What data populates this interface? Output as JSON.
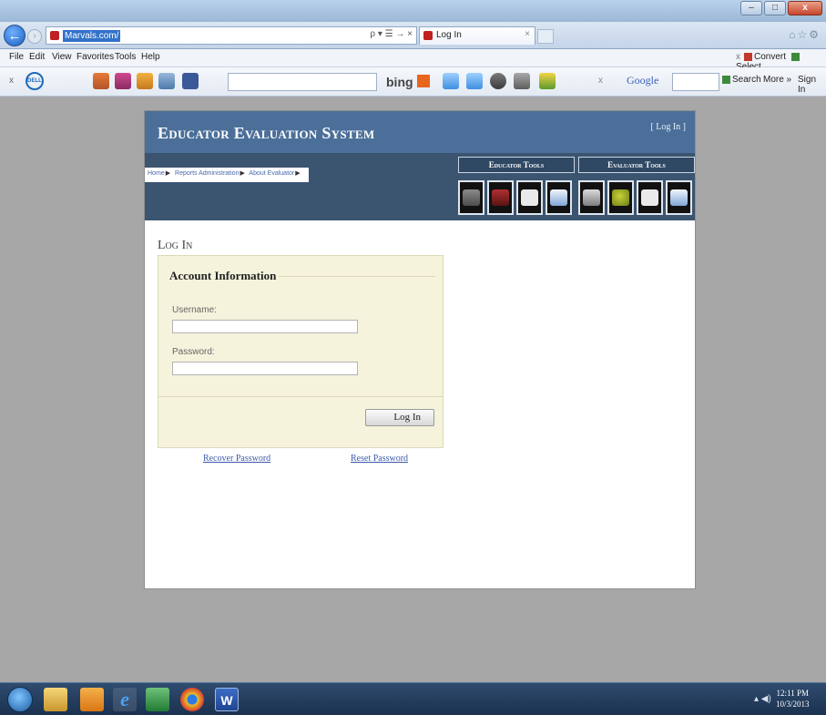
{
  "browser": {
    "url": "Marvals.com/",
    "address_controls": "ρ ▾ ☰ → ×",
    "tab_title": "Log In",
    "tab_close": "×",
    "back_glyph": "←",
    "menu": [
      "File",
      "Edit",
      "View",
      "Favorites",
      "Tools",
      "Help"
    ],
    "convert_label": "Convert",
    "select_label": "Select",
    "toolbar_close": "x",
    "bing_label": "bing",
    "google_close": "x",
    "google_label": "Google",
    "search_label": "Search",
    "more_label": "More »",
    "signin_label": "Sign In"
  },
  "site": {
    "title": "Educator Evaluation System",
    "login_link": "[ Log In ]",
    "nav": [
      "Home",
      "Reports",
      "Administration",
      "About",
      "Evaluator"
    ],
    "educator_tools": {
      "label": "Educator Tools",
      "icons": [
        "cabinet-icon",
        "suitcase-icon",
        "checkmark-icon",
        "certificate-icon"
      ]
    },
    "evaluator_tools": {
      "label": "Evaluator Tools",
      "icons": [
        "pen-icon",
        "magnifier-icon",
        "checkmark-icon",
        "certificate-icon"
      ]
    }
  },
  "login": {
    "heading": "Log In",
    "legend": "Account Information",
    "username_label": "Username:",
    "username_value": "",
    "password_label": "Password:",
    "password_value": "",
    "button_label": "Log In",
    "recover_link": "Recover Password",
    "reset_link": "Reset Password"
  },
  "taskbar": {
    "apps": [
      "windows-explorer-icon",
      "outlook-icon",
      "internet-explorer-icon",
      "excel-icon",
      "chrome-icon",
      "word-icon"
    ],
    "ie_glyph": "e",
    "word_glyph": "W",
    "time": "12:11 PM",
    "date": "10/3/2013"
  },
  "colors": {
    "header_blue": "#4b6f99",
    "nav_dark": "#3b5470",
    "login_panel": "#f5f3dc",
    "link": "#3b5aa8"
  }
}
